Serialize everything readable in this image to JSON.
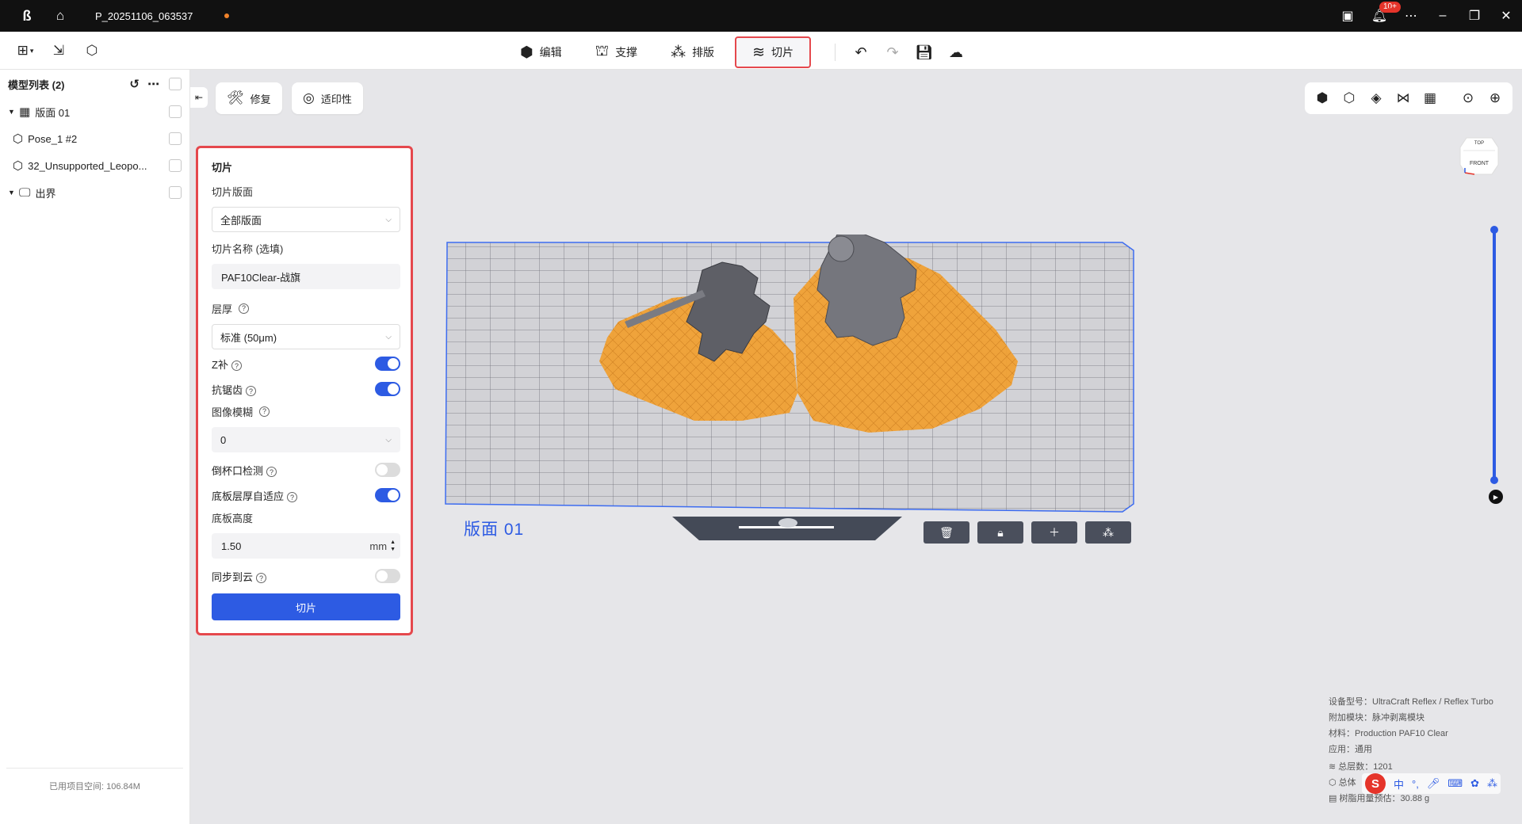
{
  "titlebar": {
    "project_name": "P_20251106_063537",
    "notifications_badge": "10+",
    "icons": [
      "app-logo",
      "home-icon",
      "message-icon",
      "bell-icon",
      "more-icon",
      "minimize-icon",
      "restore-icon",
      "close-icon"
    ]
  },
  "toolbar": {
    "tabs": [
      {
        "label": "编辑",
        "icon": "edit-cube-icon"
      },
      {
        "label": "支撑",
        "icon": "support-icon"
      },
      {
        "label": "排版",
        "icon": "layout-icon"
      },
      {
        "label": "切片",
        "icon": "slice-layers-icon",
        "active": true
      }
    ]
  },
  "sidebar": {
    "title": "模型列表 (2)",
    "items": [
      {
        "label": "版面 01",
        "type": "plate",
        "expanded": true
      },
      {
        "label": "Pose_1 #2",
        "type": "model"
      },
      {
        "label": "32_Unsupported_Leopo...",
        "type": "model"
      },
      {
        "label": "出界",
        "type": "out-of-bounds",
        "expanded": true
      }
    ],
    "footer": "已用项目空间: 106.84M"
  },
  "chips": {
    "repair": "修复",
    "printability": "适印性"
  },
  "panel": {
    "title": "切片",
    "plate_label": "切片版面",
    "plate_value": "全部版面",
    "name_label": "切片名称 (选填)",
    "name_value": "PAF10Clear-战旗",
    "layer_label": "层厚",
    "layer_value": "标准 (50μm)",
    "z_comp_label": "Z补",
    "z_comp_on": true,
    "antialias_label": "抗锯齿",
    "antialias_on": true,
    "blur_label": "图像模糊",
    "blur_value": "0",
    "cup_label": "倒杯口检测",
    "cup_on": false,
    "base_adapt_label": "底板层厚自适应",
    "base_adapt_on": true,
    "base_height_label": "底板高度",
    "base_height_value": "1.50",
    "base_height_unit": "mm",
    "cloud_label": "同步到云",
    "cloud_on": false,
    "slice_button": "切片"
  },
  "viewport": {
    "plate_name": "版面 01",
    "cube_top": "TOP",
    "cube_front": "FRONT",
    "layer_slider_level": 1.0
  },
  "info": {
    "device": "设备型号：UltraCraft Reflex / Reflex Turbo",
    "module": "附加模块：脉冲剥离模块",
    "material": "材料：Production PAF10 Clear",
    "usage": "应用：通用",
    "total_layers": "总层数：1201",
    "total_prefix": "总体",
    "resin": "树脂用量预估：30.88 g"
  },
  "ime": {
    "lang": "中"
  },
  "colors": {
    "accent": "#2d5be3",
    "highlight": "#e5484d",
    "support": "#f0a033",
    "model": "#6e6e72"
  }
}
